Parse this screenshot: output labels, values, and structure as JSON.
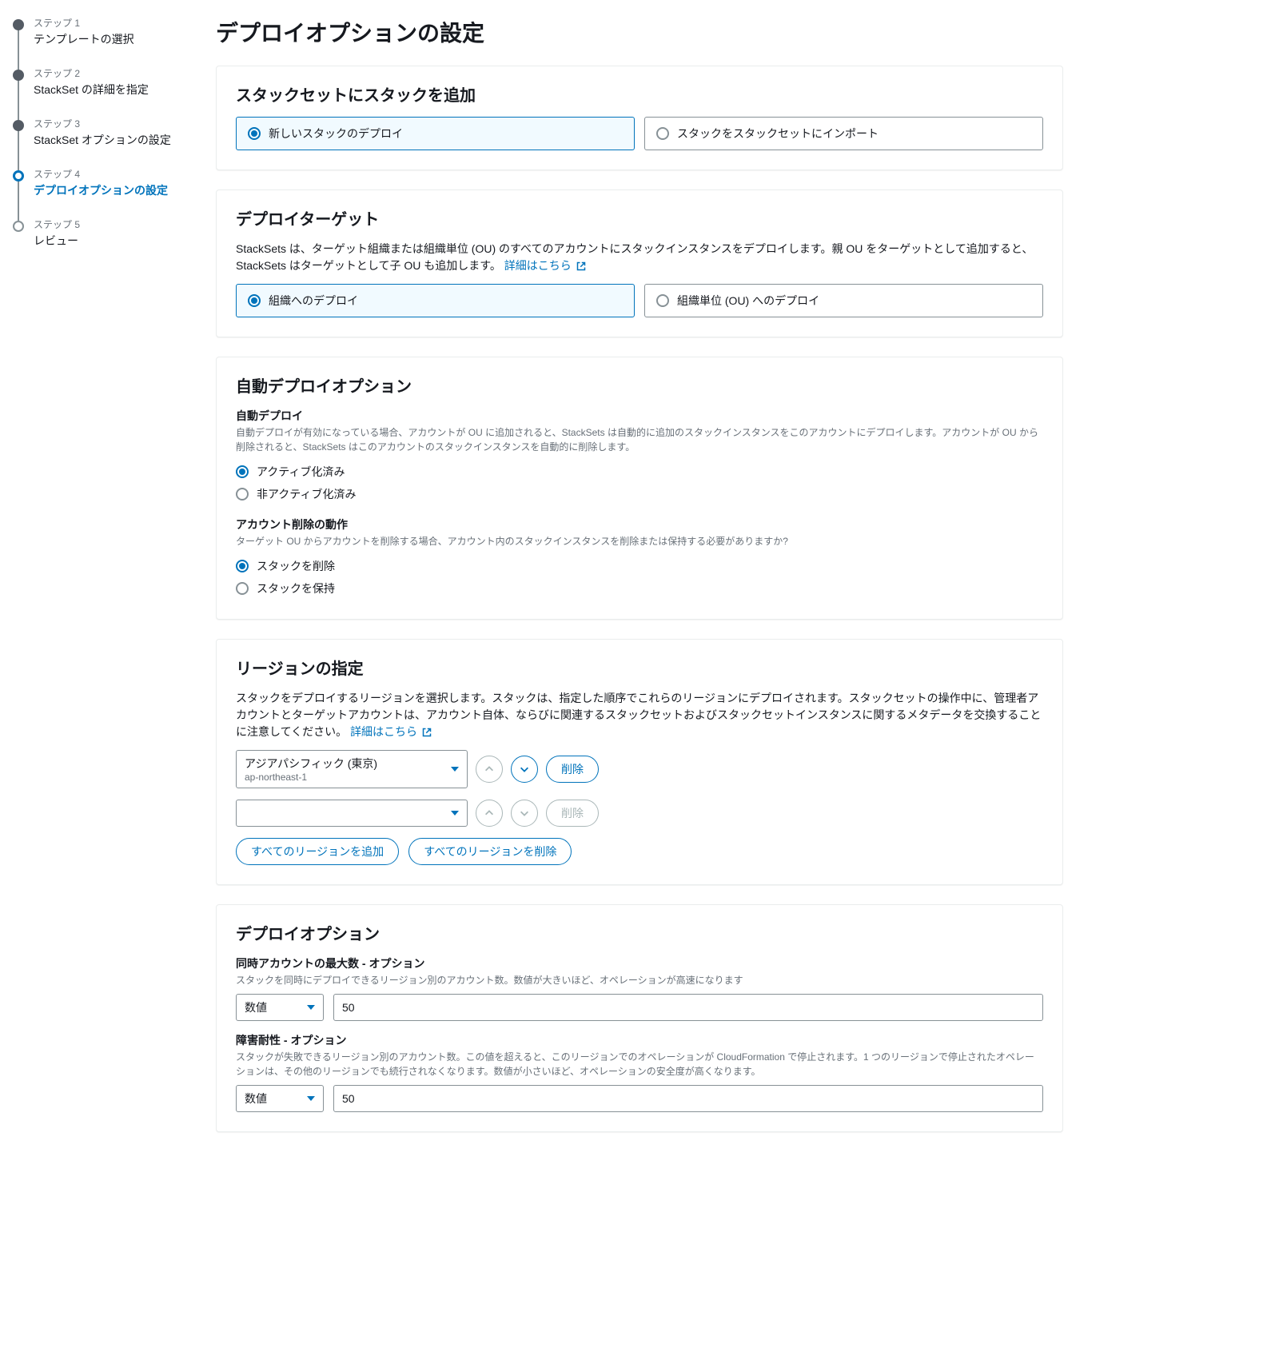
{
  "stepper": {
    "steps": [
      {
        "small": "ステップ 1",
        "label": "テンプレートの選択",
        "state": "done"
      },
      {
        "small": "ステップ 2",
        "label": "StackSet の詳細を指定",
        "state": "done"
      },
      {
        "small": "ステップ 3",
        "label": "StackSet オプションの設定",
        "state": "done"
      },
      {
        "small": "ステップ 4",
        "label": "デプロイオプションの設定",
        "state": "current"
      },
      {
        "small": "ステップ 5",
        "label": "レビュー",
        "state": "future"
      }
    ]
  },
  "page": {
    "title": "デプロイオプションの設定"
  },
  "add_stacks": {
    "title": "スタックセットにスタックを追加",
    "options": {
      "deploy_new": "新しいスタックのデプロイ",
      "import": "スタックをスタックセットにインポート"
    }
  },
  "deploy_target": {
    "title": "デプロイターゲット",
    "description": "StackSets は、ターゲット組織または組織単位 (OU) のすべてのアカウントにスタックインスタンスをデプロイします。親 OU をターゲットとして追加すると、StackSets はターゲットとして子 OU も追加します。",
    "learn_more": "詳細はこちら",
    "options": {
      "org": "組織へのデプロイ",
      "ou": "組織単位 (OU) へのデプロイ"
    }
  },
  "auto_deploy": {
    "title": "自動デプロイオプション",
    "auto_label": "自動デプロイ",
    "auto_hint": "自動デプロイが有効になっている場合、アカウントが OU に追加されると、StackSets は自動的に追加のスタックインスタンスをこのアカウントにデプロイします。アカウントが OU から削除されると、StackSets はこのアカウントのスタックインスタンスを自動的に削除します。",
    "auto_options": {
      "active": "アクティブ化済み",
      "inactive": "非アクティブ化済み"
    },
    "removal_label": "アカウント削除の動作",
    "removal_hint": "ターゲット OU からアカウントを削除する場合、アカウント内のスタックインスタンスを削除または保持する必要がありますか?",
    "removal_options": {
      "delete": "スタックを削除",
      "retain": "スタックを保持"
    }
  },
  "regions": {
    "title": "リージョンの指定",
    "description": "スタックをデプロイするリージョンを選択します。スタックは、指定した順序でこれらのリージョンにデプロイされます。スタックセットの操作中に、管理者アカウントとターゲットアカウントは、アカウント自体、ならびに関連するスタックセットおよびスタックセットインスタンスに関するメタデータを交換することに注意してください。",
    "learn_more": "詳細はこちら",
    "rows": [
      {
        "name": "アジアパシフィック (東京)",
        "code": "ap-northeast-1",
        "up_enabled": false,
        "down_enabled": true,
        "remove_enabled": true
      },
      {
        "name": "",
        "code": "",
        "up_enabled": false,
        "down_enabled": false,
        "remove_enabled": false
      }
    ],
    "remove_label": "削除",
    "add_all": "すべてのリージョンを追加",
    "remove_all": "すべてのリージョンを削除"
  },
  "deploy_opts": {
    "title": "デプロイオプション",
    "max_concurrent": {
      "label": "同時アカウントの最大数 - オプション",
      "hint": "スタックを同時にデプロイできるリージョン別のアカウント数。数値が大きいほど、オペレーションが高速になります",
      "mode": "数値",
      "value": "50"
    },
    "failure_tolerance": {
      "label": "障害耐性 - オプション",
      "hint": "スタックが失敗できるリージョン別のアカウント数。この値を超えると、このリージョンでのオペレーションが CloudFormation で停止されます。1 つのリージョンで停止されたオペレーションは、その他のリージョンでも続行されなくなります。数値が小さいほど、オペレーションの安全度が高くなります。",
      "mode": "数値",
      "value": "50"
    }
  }
}
